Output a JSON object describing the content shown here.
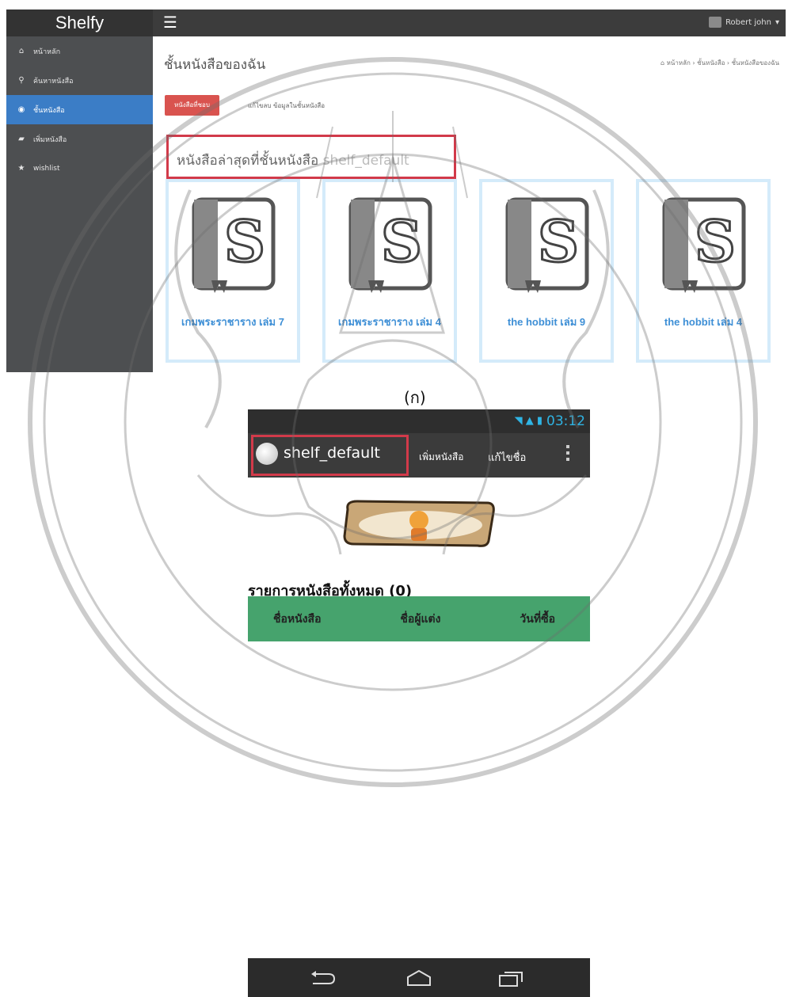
{
  "web": {
    "brand": "Shelfy",
    "user_name": "Robert john",
    "sidebar": [
      {
        "label": "หน้าหลัก",
        "icon": "home-icon"
      },
      {
        "label": "ค้นหาหนังสือ",
        "icon": "search-icon"
      },
      {
        "label": "ชั้นหนังสือ",
        "icon": "shelf-icon"
      },
      {
        "label": "เพิ่มหนังสือ",
        "icon": "book-icon"
      },
      {
        "label": "wishlist",
        "icon": "star-icon"
      }
    ],
    "page_title": "ชั้นหนังสือของฉัน",
    "breadcrumb": "หน้าหลัก › ชั้นหนังสือ › ชั้นหนังสือของฉัน",
    "tab_recent": "หนังสือที่ชอบ",
    "tab_edit": "แก้ไขลบ ข้อมูลในชั้นหนังสือ",
    "section_heading": "หนังสือล่าสุดที่ชั้นหนังสือ",
    "section_shelf": "shelf_default",
    "books": [
      {
        "title": "เกมพระราชาราง เล่ม 7"
      },
      {
        "title": "เกมพระราชาราง เล่ม 4"
      },
      {
        "title": "the hobbit เล่ม 9"
      },
      {
        "title": "the hobbit เล่ม 4"
      }
    ]
  },
  "caption": "(ก)",
  "android": {
    "clock": "03:12",
    "app_title": "shelf_default",
    "action_add": "เพิ่มหนังสือ",
    "action_edit": "แก้ไขชื่อ",
    "list_title": "รายการหนังสือทั้งหมด (0)",
    "columns": [
      "ชื่อหนังสือ",
      "ชื่อผู้แต่ง",
      "วันที่ซื้อ"
    ]
  },
  "colors": {
    "sidebar_active": "#3b7dc6",
    "highlight_border": "#d23a4a",
    "book_title": "#3e8fd6",
    "list_header": "#46a36d",
    "status_accent": "#2fb4e4"
  }
}
